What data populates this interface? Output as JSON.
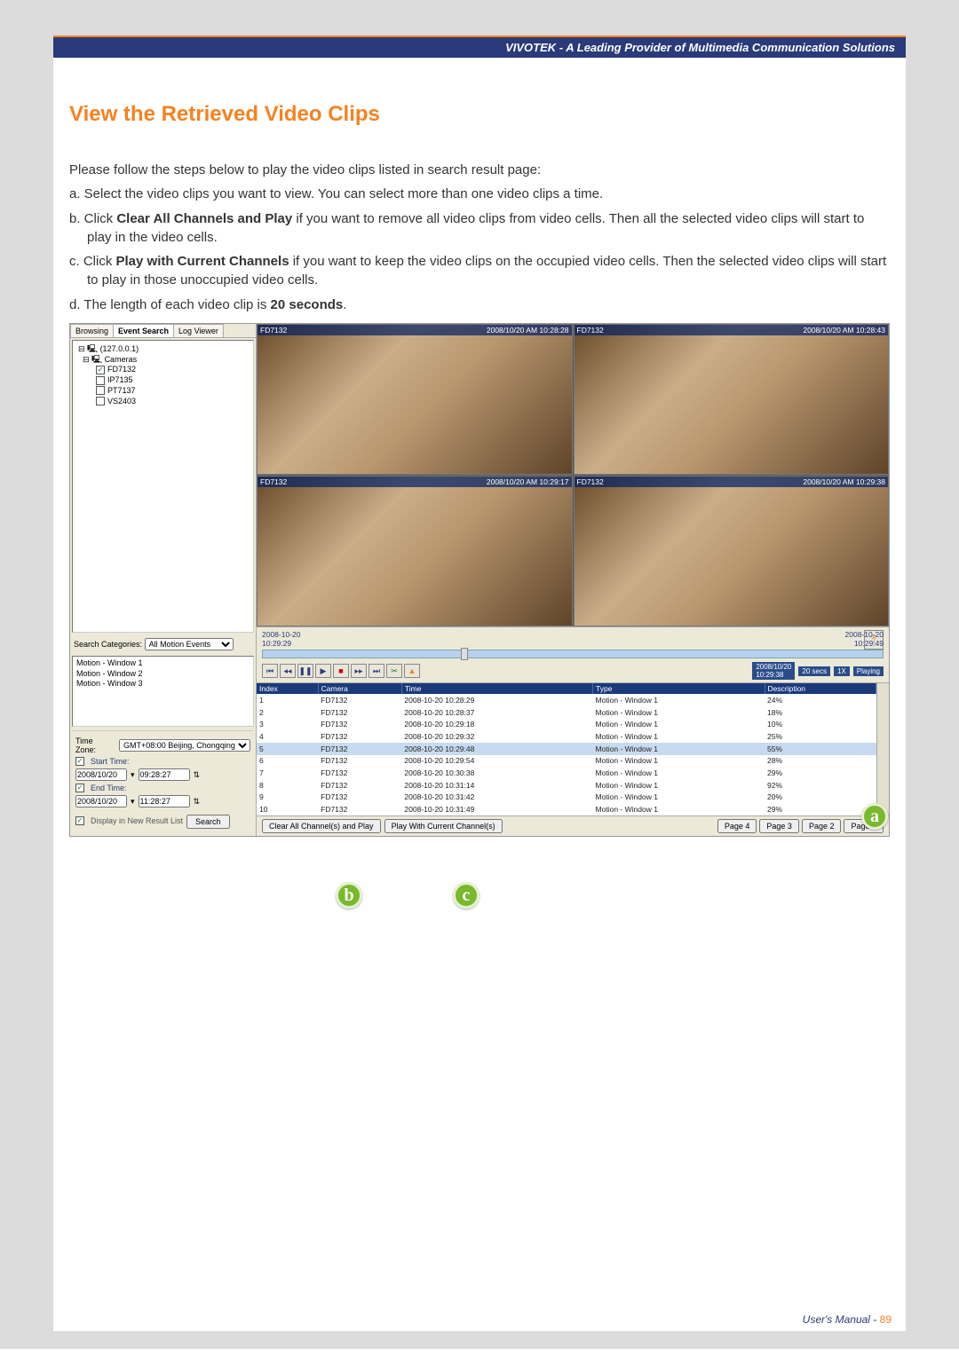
{
  "header": {
    "brand": "VIVOTEK - A Leading Provider of Multimedia Communication Solutions"
  },
  "section_title": "View the Retrieved Video Clips",
  "paragraphs": {
    "intro": "Please follow the steps below to play the video clips listed in search result page:",
    "a": "a. Select the video clips you want to view. You can select more than one video clips a time.",
    "b_pre": "b. Click ",
    "b_bold": "Clear All Channels and Play",
    "b_post": " if you want to remove all video clips from video cells. Then all the selected video clips will start to play in the video cells.",
    "c_pre": "c. Click ",
    "c_bold": "Play with Current Channels",
    "c_post": " if you want to keep the video clips on the occupied video cells. Then the selected video clips will start to play in those unoccupied video cells.",
    "d_pre": "d. The length of each video clip is ",
    "d_bold": "20 seconds",
    "d_post": "."
  },
  "tabs": {
    "browsing": "Browsing",
    "event_search": "Event Search",
    "log_viewer": "Log Viewer"
  },
  "tree": {
    "root": "(127.0.0.1)",
    "cameras_label": "Cameras",
    "items": [
      {
        "checked": true,
        "label": "FD7132"
      },
      {
        "checked": false,
        "label": "IP7135"
      },
      {
        "checked": false,
        "label": "PT7137"
      },
      {
        "checked": false,
        "label": "VS2403"
      }
    ]
  },
  "search_categories": {
    "label": "Search Categories:",
    "value": "All Motion Events"
  },
  "motion_windows": [
    "Motion - Window 1",
    "Motion - Window 2",
    "Motion - Window 3"
  ],
  "time_panel": {
    "tz_label": "Time Zone:",
    "tz_value": "GMT+08:00 Beijing, Chongqing",
    "start_label": "Start Time:",
    "start_date": "2008/10/20",
    "start_time": "09:28:27",
    "end_label": "End Time:",
    "end_date": "2008/10/20",
    "end_time": "11:28:27",
    "display_new": "Display in New Result List",
    "search_btn": "Search"
  },
  "cells": [
    {
      "name": "FD7132",
      "ts": "2008/10/20 AM 10:28:28"
    },
    {
      "name": "FD7132",
      "ts": "2008/10/20 AM 10:28:43"
    },
    {
      "name": "FD7132",
      "ts": "2008/10/20 AM 10:29:17"
    },
    {
      "name": "FD7132",
      "ts": "2008/10/20 AM 10:29:38"
    }
  ],
  "slider": {
    "left_date": "2008-10-20",
    "left_time": "10:29:29",
    "right_date": "2008-10-20",
    "right_time": "10:29:49",
    "pos_date": "2008/10/20",
    "pos_time": "10:29:38",
    "len": "20 secs",
    "rate": "1X",
    "state": "Playing"
  },
  "results": {
    "headers": {
      "index": "Index",
      "camera": "Camera",
      "time": "Time",
      "type": "Type",
      "desc": "Description"
    },
    "rows": [
      {
        "index": "1",
        "camera": "FD7132",
        "time": "2008-10-20 10:28:29",
        "type": "Motion - Window 1",
        "desc": "24%"
      },
      {
        "index": "2",
        "camera": "FD7132",
        "time": "2008-10-20 10:28:37",
        "type": "Motion - Window 1",
        "desc": "18%"
      },
      {
        "index": "3",
        "camera": "FD7132",
        "time": "2008-10-20 10:29:18",
        "type": "Motion - Window 1",
        "desc": "10%"
      },
      {
        "index": "4",
        "camera": "FD7132",
        "time": "2008-10-20 10:29:32",
        "type": "Motion - Window 1",
        "desc": "25%"
      },
      {
        "index": "5",
        "camera": "FD7132",
        "time": "2008-10-20 10:29:48",
        "type": "Motion - Window 1",
        "desc": "55%"
      },
      {
        "index": "6",
        "camera": "FD7132",
        "time": "2008-10-20 10:29:54",
        "type": "Motion - Window 1",
        "desc": "28%"
      },
      {
        "index": "7",
        "camera": "FD7132",
        "time": "2008-10-20 10:30:38",
        "type": "Motion - Window 1",
        "desc": "29%"
      },
      {
        "index": "8",
        "camera": "FD7132",
        "time": "2008-10-20 10:31:14",
        "type": "Motion - Window 1",
        "desc": "92%"
      },
      {
        "index": "9",
        "camera": "FD7132",
        "time": "2008-10-20 10:31:42",
        "type": "Motion - Window 1",
        "desc": "20%"
      },
      {
        "index": "10",
        "camera": "FD7132",
        "time": "2008-10-20 10:31:49",
        "type": "Motion - Window 1",
        "desc": "29%"
      }
    ]
  },
  "bottom": {
    "clear": "Clear All Channel(s) and Play",
    "playwith": "Play With Current Channel(s)",
    "pages": [
      "Page 4",
      "Page 3",
      "Page 2",
      "Page 1"
    ]
  },
  "annotations": {
    "a": "a",
    "b": "b",
    "c": "c"
  },
  "footer": {
    "label": "User's Manual - ",
    "page": "89"
  }
}
